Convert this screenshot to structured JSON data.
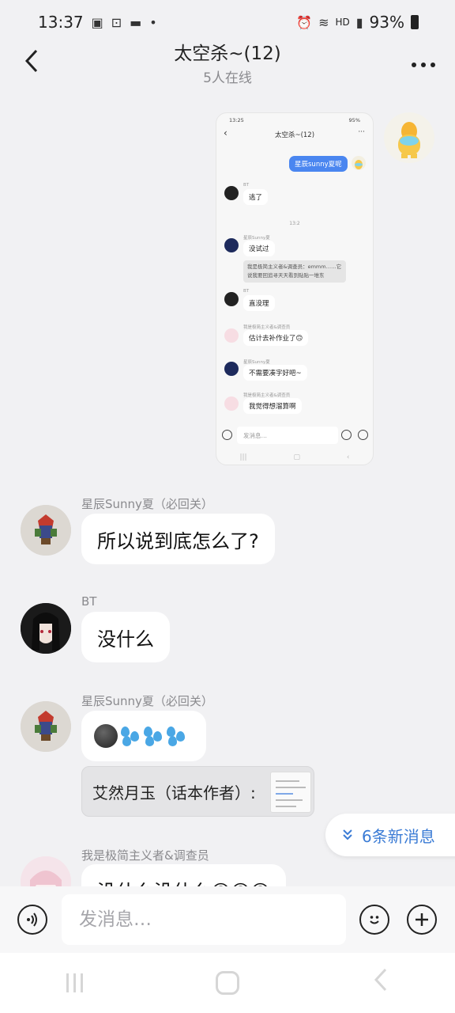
{
  "status": {
    "time": "13:37",
    "battery": "93%",
    "network_label": "HD",
    "icons": [
      "gallery-icon",
      "screenshot-icon",
      "message-icon",
      "dot-icon",
      "alarm-icon",
      "wifi-icon",
      "signal-5g-icon",
      "battery-icon"
    ]
  },
  "header": {
    "title": "太空杀~(12)",
    "subtitle": "5人在线"
  },
  "screenshot": {
    "time": "13:25",
    "battery": "95%",
    "title": "太空杀~(12)",
    "self_message": "星辰sunny夏呢",
    "messages": [
      {
        "name": "BT",
        "text": "逃了"
      },
      {
        "time": "13:2"
      },
      {
        "name": "星辰Sunny夏",
        "text": "没试过"
      },
      {
        "quote": "我是极简主义者&调查员：emmm……它说我要回追寻天天看到贴贴一堆东"
      },
      {
        "name": "BT",
        "text": "直没理"
      },
      {
        "name": "我是极简主义者&调查员",
        "text": "估计去补作业了🙃"
      },
      {
        "name": "星辰Sunny夏",
        "text": "不需要凑字好吧~"
      },
      {
        "name": "我是极简主义者&调查员",
        "text": "我觉得想溜算啊"
      }
    ],
    "input_placeholder": "发消息…"
  },
  "messages": [
    {
      "sender": "星辰Sunny夏（必回关）",
      "text": "所以说到底怎么了?"
    },
    {
      "sender": "BT",
      "text": "没什么"
    },
    {
      "sender": "星辰Sunny夏（必回关）",
      "text": ""
    },
    {
      "sender": "我是极简主义者&调查员",
      "text": "没什么没什么🙃🙃🙃"
    }
  ],
  "quote": {
    "text": "艾然月玉（话本作者）:"
  },
  "new_messages": {
    "label": "6条新消息"
  },
  "input": {
    "placeholder": "发消息…"
  },
  "colors": {
    "background": "#f1f1f3",
    "accent": "#3a7bd5",
    "self_bubble": "#4a86f0"
  }
}
